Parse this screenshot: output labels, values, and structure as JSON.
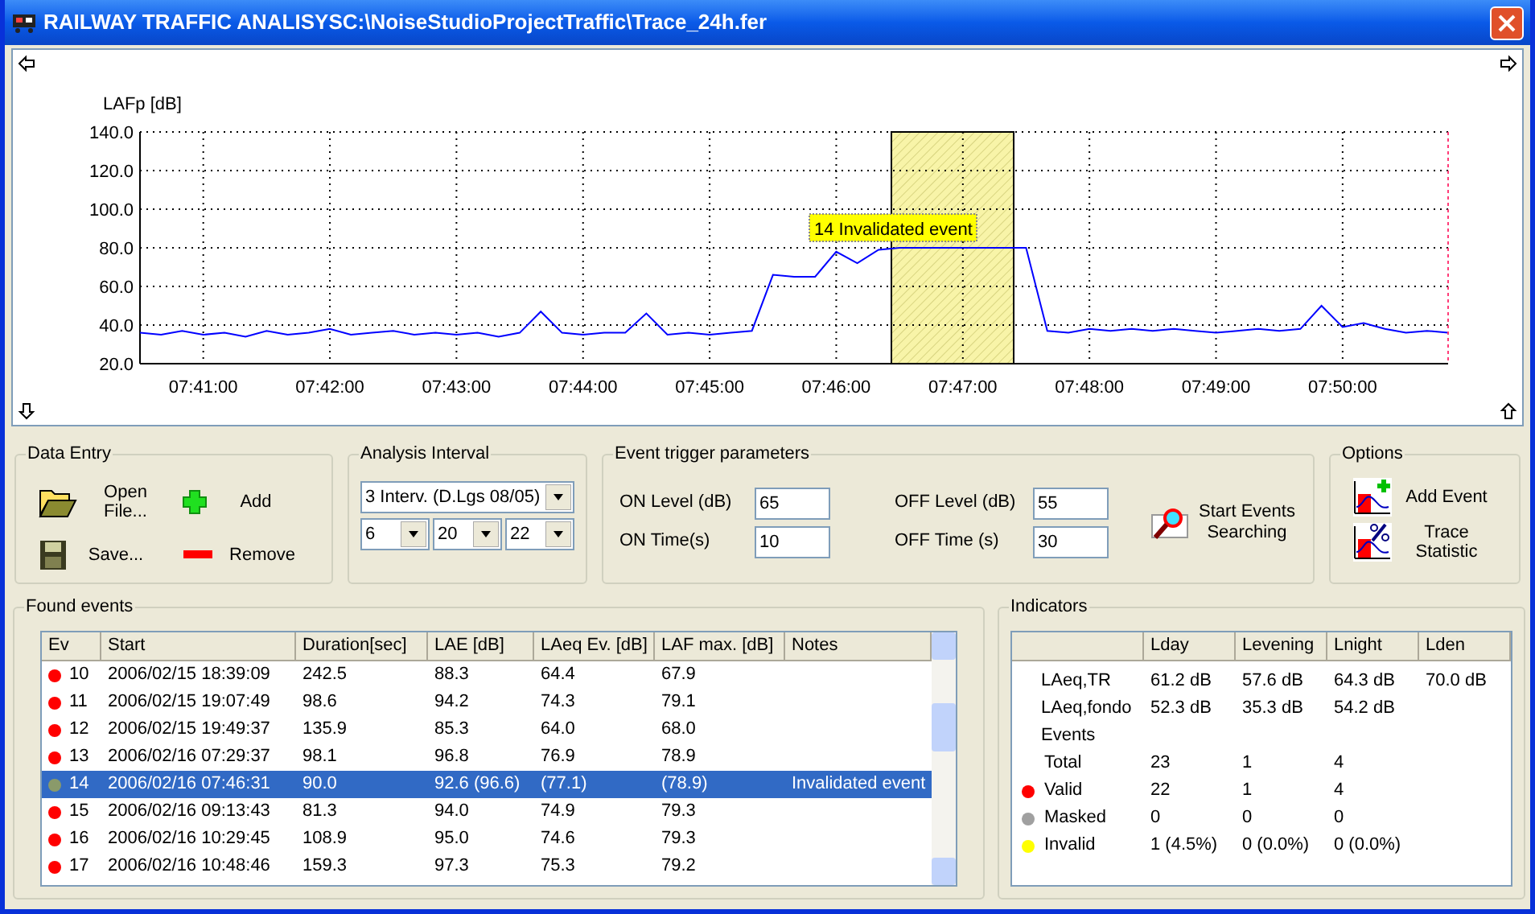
{
  "window": {
    "title": "RAILWAY TRAFFIC ANALISYSC:\\NoiseStudioProjectTraffic\\Trace_24h.fer"
  },
  "chart": {
    "chart_data": {
      "type": "line",
      "grid": true,
      "ylabel": "LAFp [dB]",
      "ylim": [
        20,
        140
      ],
      "yticks": [
        {
          "value": 140,
          "label": "140.0"
        },
        {
          "value": 120,
          "label": "120.0"
        },
        {
          "value": 100,
          "label": "100.0"
        },
        {
          "value": 80,
          "label": "80.0"
        },
        {
          "value": 60,
          "label": "60.0"
        },
        {
          "value": 40,
          "label": "40.0"
        },
        {
          "value": 20,
          "label": "20.0"
        }
      ],
      "categories": [
        null,
        null,
        null,
        "07:41:00",
        null,
        null,
        null,
        null,
        null,
        "07:42:00",
        null,
        null,
        null,
        null,
        null,
        "07:43:00",
        null,
        null,
        null,
        null,
        null,
        "07:44:00",
        null,
        null,
        null,
        null,
        null,
        "07:45:00",
        null,
        null,
        null,
        null,
        null,
        "07:46:00",
        null,
        null,
        null,
        null,
        null,
        "07:47:00",
        null,
        null,
        null,
        null,
        null,
        "07:48:00",
        null,
        null,
        null,
        null,
        null,
        "07:49:00",
        null,
        null,
        null,
        null,
        null,
        "07:50:00",
        null,
        null,
        null,
        null,
        null
      ],
      "series": [
        {
          "color": "#0000ff",
          "values": [
            36,
            35,
            37,
            35,
            36,
            34,
            37,
            35,
            36,
            38,
            35,
            36,
            37,
            35,
            36,
            35,
            36,
            34,
            36,
            47,
            36,
            35,
            36,
            36,
            46,
            35,
            36,
            35,
            36,
            37,
            66,
            65,
            65,
            78,
            72,
            79,
            80,
            80,
            80,
            80,
            80,
            80,
            80,
            37,
            36,
            38,
            37,
            38,
            37,
            38,
            37,
            36,
            37,
            38,
            37,
            38,
            50,
            39,
            41,
            38,
            36,
            37,
            36
          ]
        }
      ],
      "annotations": [
        {
          "text": "14 Invalidated event"
        }
      ]
    }
  },
  "data_entry": {
    "title": "Data Entry",
    "buttons": [
      {
        "kind": "open",
        "label": "Open File..."
      },
      {
        "kind": "add",
        "label": "Add"
      },
      {
        "kind": "save",
        "label": "Save..."
      },
      {
        "kind": "remove",
        "label": "Remove"
      }
    ]
  },
  "analysis_interval": {
    "title": "Analysis Interval",
    "mode": "3 Interv. (D.Lgs 08/05)",
    "hours": [
      "6",
      "20",
      "22"
    ]
  },
  "trigger": {
    "title": "Event trigger parameters",
    "fields": [
      {
        "label": "ON Level (dB)",
        "value": "65"
      },
      {
        "label": "OFF Level (dB)",
        "value": "55"
      },
      {
        "label": "ON Time(s)",
        "value": "10"
      },
      {
        "label": "OFF Time (s)",
        "value": "30"
      }
    ],
    "search_button": "Start Events Searching"
  },
  "options": {
    "title": "Options",
    "buttons": [
      {
        "kind": "add-event",
        "label": "Add Event"
      },
      {
        "kind": "statistic",
        "label": "Trace Statistic"
      }
    ]
  },
  "events": {
    "title": "Found events",
    "columns": [
      "Ev",
      "Start",
      "Duration[sec]",
      "LAE [dB]",
      "LAeq Ev. [dB]",
      "LAF max. [dB]",
      "Notes"
    ],
    "rows": [
      {
        "cells": [
          "10",
          "2006/02/15 18:39:09",
          "242.5",
          "88.3",
          "64.4",
          "67.9",
          ""
        ],
        "color": "#ff0000",
        "selected": false
      },
      {
        "cells": [
          "11",
          "2006/02/15 19:07:49",
          "98.6",
          "94.2",
          "74.3",
          "79.1",
          ""
        ],
        "color": "#ff0000",
        "selected": false
      },
      {
        "cells": [
          "12",
          "2006/02/15 19:49:37",
          "135.9",
          "85.3",
          "64.0",
          "68.0",
          ""
        ],
        "color": "#ff0000",
        "selected": false
      },
      {
        "cells": [
          "13",
          "2006/02/16 07:29:37",
          "98.1",
          "96.8",
          "76.9",
          "78.9",
          ""
        ],
        "color": "#ff0000",
        "selected": false
      },
      {
        "cells": [
          "14",
          "2006/02/16 07:46:31",
          "90.0",
          "92.6 (96.6)",
          "(77.1)",
          "(78.9)",
          "Invalidated event"
        ],
        "color": "#8a9a6a",
        "selected": true
      },
      {
        "cells": [
          "15",
          "2006/02/16 09:13:43",
          "81.3",
          "94.0",
          "74.9",
          "79.3",
          ""
        ],
        "color": "#ff0000",
        "selected": false
      },
      {
        "cells": [
          "16",
          "2006/02/16 10:29:45",
          "108.9",
          "95.0",
          "74.6",
          "79.3",
          ""
        ],
        "color": "#ff0000",
        "selected": false
      },
      {
        "cells": [
          "17",
          "2006/02/16 10:48:46",
          "159.3",
          "97.3",
          "75.3",
          "79.2",
          ""
        ],
        "color": "#ff0000",
        "selected": false
      }
    ]
  },
  "indicators": {
    "title": "Indicators",
    "columns": [
      "Lday",
      "Levening",
      "Lnight",
      "Lden"
    ],
    "rows": [
      {
        "kind": "value",
        "label": "LAeq,TR",
        "values": [
          "61.2 dB",
          "57.6 dB",
          "64.3 dB",
          "70.0 dB"
        ]
      },
      {
        "kind": "value",
        "label": "LAeq,fondo",
        "values": [
          "52.3 dB",
          "35.3 dB",
          "54.2 dB"
        ]
      },
      {
        "kind": "heading",
        "label": "Events",
        "values": []
      },
      {
        "kind": "count",
        "label": "Total",
        "values": [
          "23",
          "1",
          "4"
        ]
      },
      {
        "kind": "count",
        "label": "Valid",
        "color": "#ff0000",
        "values": [
          "22",
          "1",
          "4"
        ]
      },
      {
        "kind": "count",
        "label": "Masked",
        "color": "#a0a0a0",
        "values": [
          "0",
          "0",
          "0"
        ]
      },
      {
        "kind": "count",
        "label": "Invalid",
        "color": "#ffff00",
        "values": [
          "1 (4.5%)",
          "0 (0.0%)",
          "0 (0.0%)"
        ]
      }
    ]
  }
}
